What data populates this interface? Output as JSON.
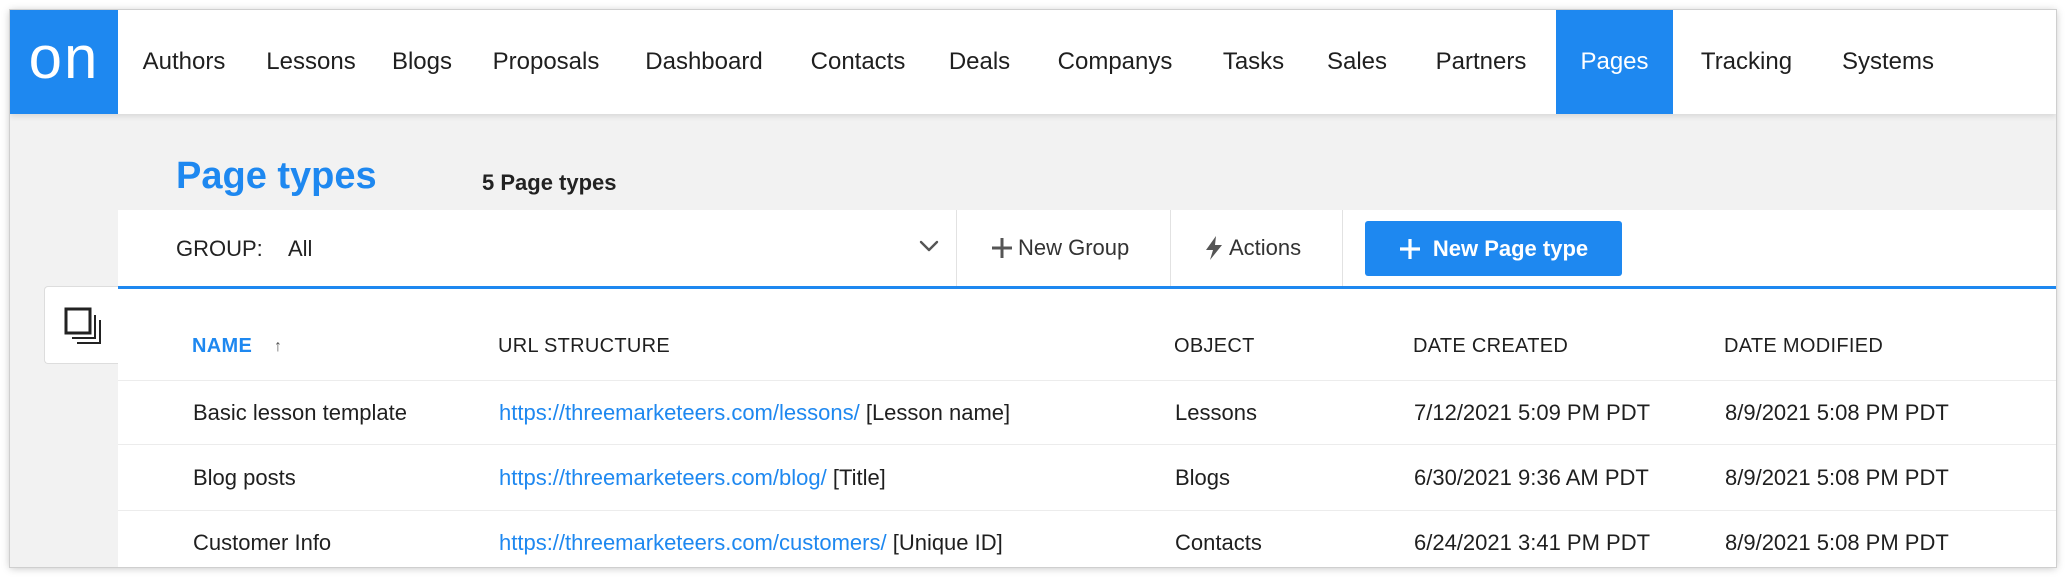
{
  "logo": {
    "text": "on"
  },
  "nav": {
    "items": [
      {
        "label": "Authors"
      },
      {
        "label": "Lessons"
      },
      {
        "label": "Blogs"
      },
      {
        "label": "Proposals"
      },
      {
        "label": "Dashboard"
      },
      {
        "label": "Contacts"
      },
      {
        "label": "Deals"
      },
      {
        "label": "Companys"
      },
      {
        "label": "Tasks"
      },
      {
        "label": "Sales"
      },
      {
        "label": "Partners"
      },
      {
        "label": "Pages",
        "active": true
      },
      {
        "label": "Tracking"
      },
      {
        "label": "Systems"
      }
    ]
  },
  "header": {
    "title": "Page types",
    "count": "5 Page types"
  },
  "toolbar": {
    "group_label": "GROUP:",
    "group_value": "All",
    "new_group_label": "New Group",
    "actions_label": "Actions",
    "new_page_type_label": "New Page type"
  },
  "table": {
    "columns": [
      {
        "label": "NAME",
        "sorted": "asc",
        "sort_glyph": "↑"
      },
      {
        "label": "URL STRUCTURE"
      },
      {
        "label": "OBJECT"
      },
      {
        "label": "DATE CREATED"
      },
      {
        "label": "DATE MODIFIED"
      }
    ],
    "rows": [
      {
        "name": "Basic lesson template",
        "url": "https://threemarketeers.com/lessons/",
        "url_suffix": "[Lesson name]",
        "object": "Lessons",
        "created": "7/12/2021 5:09 PM PDT",
        "modified": "8/9/2021 5:08 PM PDT"
      },
      {
        "name": "Blog posts",
        "url": "https://threemarketeers.com/blog/",
        "url_suffix": "[Title]",
        "object": "Blogs",
        "created": "6/30/2021 9:36 AM PDT",
        "modified": "8/9/2021 5:08 PM PDT"
      },
      {
        "name": "Customer Info",
        "url": "https://threemarketeers.com/customers/",
        "url_suffix": "[Unique ID]",
        "object": "Contacts",
        "created": "6/24/2021 3:41 PM PDT",
        "modified": "8/9/2021 5:08 PM PDT"
      }
    ]
  },
  "colors": {
    "accent": "#1e88f0",
    "text": "#1f1f1f",
    "background": "#f2f2f2"
  },
  "icons": {
    "side": "layers-icon",
    "dropdown": "chevron-down-icon",
    "new_group": "plus-icon",
    "actions": "lightning-icon",
    "new_page_type": "plus-icon"
  }
}
